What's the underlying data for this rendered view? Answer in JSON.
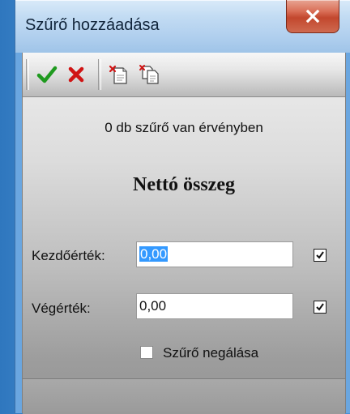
{
  "window": {
    "title": "Szűrő hozzáadása"
  },
  "toolbar": {
    "buttons": [
      {
        "name": "accept",
        "icon": "green-checkmark-icon",
        "color": "#1f9a1f"
      },
      {
        "name": "cancel",
        "icon": "red-x-icon",
        "color": "#d01414"
      },
      {
        "name": "new-filter",
        "icon": "new-document-icon"
      },
      {
        "name": "copy-filter",
        "icon": "copy-documents-icon"
      }
    ]
  },
  "filter": {
    "active_count_text": "0 db szűrő van érvényben",
    "field_name": "Nettó összeg",
    "start": {
      "label": "Kezdőérték:",
      "value": "0,00",
      "selected": true,
      "enabled": true
    },
    "end": {
      "label": "Végérték:",
      "value": "0,00",
      "selected": false,
      "enabled": true
    },
    "negate": {
      "label": "Szűrő negálása",
      "checked": false
    }
  },
  "colors": {
    "selection": "#3399ff",
    "close_button": "#c2472d"
  }
}
